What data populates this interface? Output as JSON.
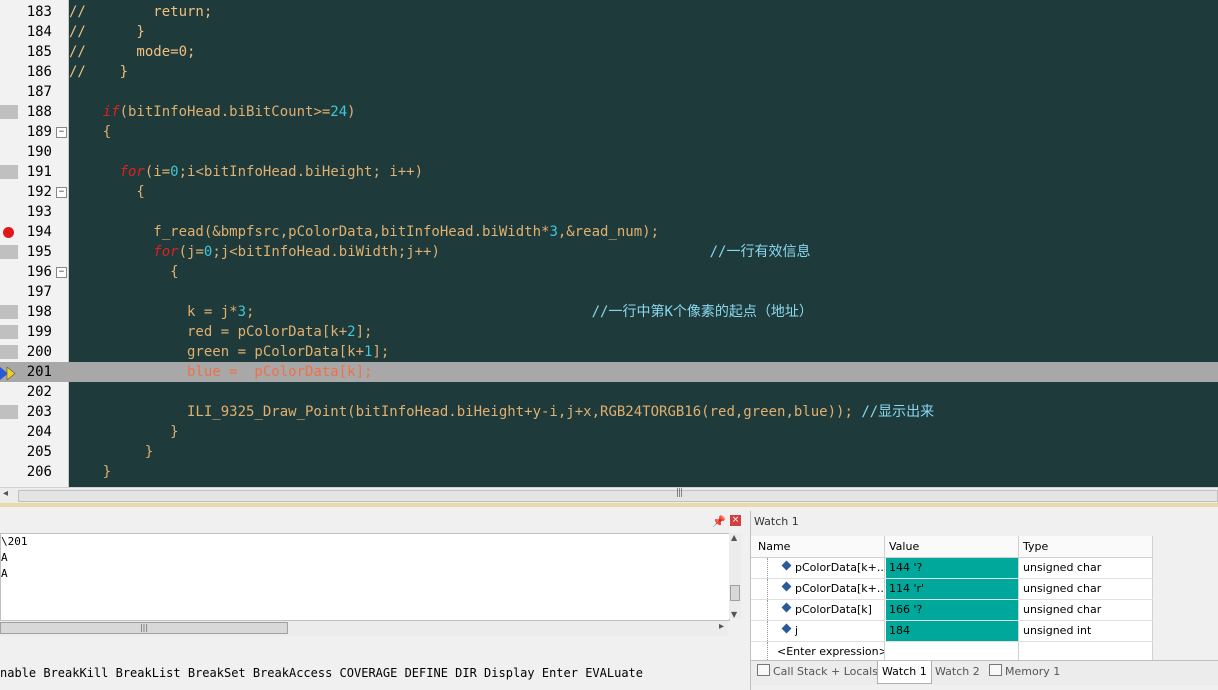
{
  "editor": {
    "lines": [
      {
        "num": "183",
        "mark": "",
        "fold": "",
        "segments": [
          {
            "t": "//        return;",
            "c": "#f0c080"
          }
        ]
      },
      {
        "num": "184",
        "mark": "",
        "fold": "",
        "segments": [
          {
            "t": "//      }",
            "c": "#f0c080"
          }
        ]
      },
      {
        "num": "185",
        "mark": "",
        "fold": "",
        "segments": [
          {
            "t": "//      mode=0;",
            "c": "#f0c080"
          }
        ]
      },
      {
        "num": "186",
        "mark": "",
        "fold": "",
        "segments": [
          {
            "t": "//    }",
            "c": "#f0c080"
          }
        ]
      },
      {
        "num": "187",
        "mark": "",
        "fold": "",
        "segments": [
          {
            "t": "",
            "c": "#e0b070"
          }
        ]
      },
      {
        "num": "188",
        "mark": "sq",
        "fold": "",
        "segments": [
          {
            "t": "    ",
            "c": "#e0b070"
          },
          {
            "t": "if",
            "c": "#e02020",
            "i": true
          },
          {
            "t": "(bitInfoHead.biBitCount>=",
            "c": "#e0b070"
          },
          {
            "t": "24",
            "c": "#40c8d8"
          },
          {
            "t": ")",
            "c": "#e0b070"
          }
        ]
      },
      {
        "num": "189",
        "mark": "",
        "fold": "−",
        "segments": [
          {
            "t": "    {",
            "c": "#e0b070"
          }
        ]
      },
      {
        "num": "190",
        "mark": "",
        "fold": "",
        "segments": [
          {
            "t": "",
            "c": "#e0b070"
          }
        ]
      },
      {
        "num": "191",
        "mark": "sq",
        "fold": "",
        "segments": [
          {
            "t": "      ",
            "c": "#e0b070"
          },
          {
            "t": "for",
            "c": "#e02020",
            "i": true
          },
          {
            "t": "(i=",
            "c": "#e0b070"
          },
          {
            "t": "0",
            "c": "#40c8d8"
          },
          {
            "t": ";i<bitInfoHead.biHeight; i++)",
            "c": "#e0b070"
          }
        ]
      },
      {
        "num": "192",
        "mark": "",
        "fold": "−",
        "segments": [
          {
            "t": "        {",
            "c": "#e0b070"
          }
        ]
      },
      {
        "num": "193",
        "mark": "",
        "fold": "",
        "segments": [
          {
            "t": "",
            "c": "#e0b070"
          }
        ]
      },
      {
        "num": "194",
        "mark": "bp",
        "fold": "",
        "segments": [
          {
            "t": "          f_read(&bmpfsrc,pColorData,bitInfoHead.biWidth*",
            "c": "#e0b070"
          },
          {
            "t": "3",
            "c": "#40c8d8"
          },
          {
            "t": ",&read_num);",
            "c": "#e0b070"
          }
        ]
      },
      {
        "num": "195",
        "mark": "sq",
        "fold": "",
        "segments": [
          {
            "t": "          ",
            "c": "#e0b070"
          },
          {
            "t": "for",
            "c": "#e02020",
            "i": true
          },
          {
            "t": "(j=",
            "c": "#e0b070"
          },
          {
            "t": "0",
            "c": "#40c8d8"
          },
          {
            "t": ";j<bitInfoHead.biWidth;j++)                                ",
            "c": "#e0b070"
          },
          {
            "t": "//一行有效信息",
            "c": "#8ad8f0"
          }
        ]
      },
      {
        "num": "196",
        "mark": "",
        "fold": "−",
        "segments": [
          {
            "t": "            {",
            "c": "#e0b070"
          }
        ]
      },
      {
        "num": "197",
        "mark": "",
        "fold": "",
        "segments": [
          {
            "t": "",
            "c": "#e0b070"
          }
        ]
      },
      {
        "num": "198",
        "mark": "sq",
        "fold": "",
        "segments": [
          {
            "t": "              k = j*",
            "c": "#e0b070"
          },
          {
            "t": "3",
            "c": "#40c8d8"
          },
          {
            "t": ";                                        ",
            "c": "#e0b070"
          },
          {
            "t": "//一行中第K个像素的起点（地址）",
            "c": "#8ad8f0"
          }
        ]
      },
      {
        "num": "199",
        "mark": "sq",
        "fold": "",
        "segments": [
          {
            "t": "              red = pColorData[k+",
            "c": "#e0b070"
          },
          {
            "t": "2",
            "c": "#40c8d8"
          },
          {
            "t": "];",
            "c": "#e0b070"
          }
        ]
      },
      {
        "num": "200",
        "mark": "sq",
        "fold": "",
        "segments": [
          {
            "t": "              green = pColorData[k+",
            "c": "#e0b070"
          },
          {
            "t": "1",
            "c": "#40c8d8"
          },
          {
            "t": "];",
            "c": "#e0b070"
          }
        ]
      },
      {
        "num": "201",
        "mark": "arrow",
        "fold": "",
        "cur": true,
        "segments": [
          {
            "t": "              blue =  pColorData[k];",
            "c": "#f07048"
          }
        ]
      },
      {
        "num": "202",
        "mark": "",
        "fold": "",
        "segments": [
          {
            "t": "",
            "c": "#e0b070"
          }
        ]
      },
      {
        "num": "203",
        "mark": "sq",
        "fold": "",
        "segments": [
          {
            "t": "              ILI_9325_Draw_Point(bitInfoHead.biHeight+y-i,j+x,RGB24TORGB16(red,green,blue)); ",
            "c": "#e0b070"
          },
          {
            "t": "//显示出来",
            "c": "#8ad8f0"
          }
        ]
      },
      {
        "num": "204",
        "mark": "",
        "fold": "",
        "segments": [
          {
            "t": "            }",
            "c": "#e0b070"
          }
        ]
      },
      {
        "num": "205",
        "mark": "",
        "fold": "",
        "segments": [
          {
            "t": "         }",
            "c": "#e0b070"
          }
        ]
      },
      {
        "num": "206",
        "mark": "",
        "fold": "",
        "segments": [
          {
            "t": "    }",
            "c": "#e0b070"
          }
        ]
      }
    ]
  },
  "command": {
    "output": "\\201\nA\nA",
    "input_line": "nable BreakKill BreakList BreakSet BreakAccess COVERAGE DEFINE DIR Display Enter EVALuate"
  },
  "watch": {
    "title": "Watch 1",
    "headers": {
      "name": "Name",
      "value": "Value",
      "type": "Type"
    },
    "rows": [
      {
        "name": "pColorData[k+...",
        "value": "144 '?",
        "type": "unsigned char"
      },
      {
        "name": "pColorData[k+...",
        "value": "114 'r'",
        "type": "unsigned char"
      },
      {
        "name": "pColorData[k]",
        "value": "166 '?",
        "type": "unsigned char"
      },
      {
        "name": "j",
        "value": "184",
        "type": "unsigned int"
      }
    ],
    "enter_expression": "<Enter expression>",
    "tabs": [
      {
        "label": "Call Stack + Locals",
        "active": false
      },
      {
        "label": "Watch 1",
        "active": true
      },
      {
        "label": "Watch 2",
        "active": false
      },
      {
        "label": "Memory 1",
        "active": false
      }
    ]
  }
}
